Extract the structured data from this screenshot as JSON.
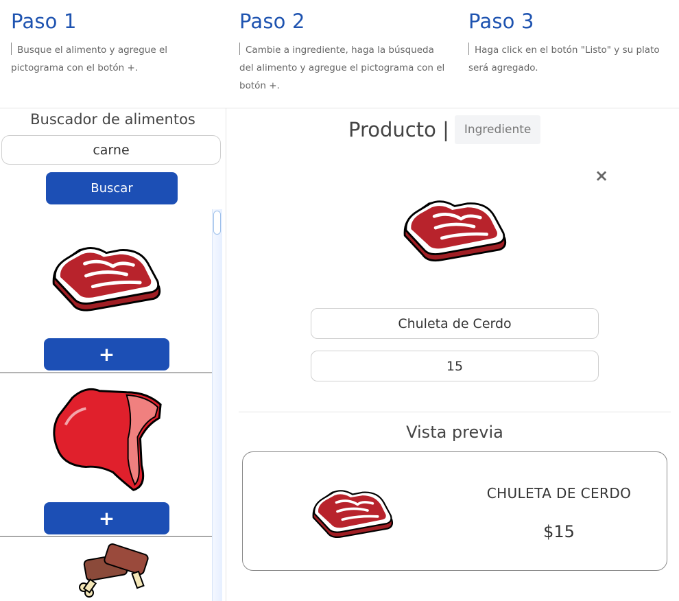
{
  "steps": [
    {
      "title": "Paso 1",
      "text": "Busque el alimento y agregue el pictograma con el botón +."
    },
    {
      "title": "Paso 2",
      "text": "Cambie a ingrediente, haga la búsqueda del alimento y agregue el pictograma con el botón +."
    },
    {
      "title": "Paso 3",
      "text": "Haga click en el botón \"Listo\" y su plato será agregado."
    }
  ],
  "search": {
    "title": "Buscador de alimentos",
    "value": "carne",
    "button_label": "Buscar"
  },
  "results": [
    {
      "icon": "meat-steak-icon",
      "add_label": "+"
    },
    {
      "icon": "pork-chop-icon",
      "add_label": "+"
    },
    {
      "icon": "ribs-icon"
    }
  ],
  "editor": {
    "tab_product": "Producto |",
    "tab_ingredient": "Ingrediente",
    "close_label": "×",
    "name_value": "Chuleta de Cerdo",
    "price_value": "15"
  },
  "preview": {
    "title": "Vista previa",
    "name": "CHULETA DE CERDO",
    "price": "$15"
  },
  "colors": {
    "primary": "#1c4fb5",
    "heading": "#1e53b0"
  }
}
